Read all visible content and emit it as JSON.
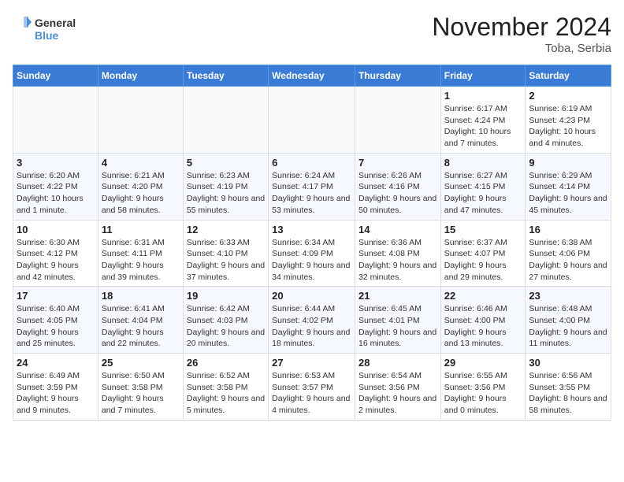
{
  "header": {
    "logo_line1": "General",
    "logo_line2": "Blue",
    "month": "November 2024",
    "location": "Toba, Serbia"
  },
  "days_of_week": [
    "Sunday",
    "Monday",
    "Tuesday",
    "Wednesday",
    "Thursday",
    "Friday",
    "Saturday"
  ],
  "weeks": [
    [
      {
        "day": "",
        "info": ""
      },
      {
        "day": "",
        "info": ""
      },
      {
        "day": "",
        "info": ""
      },
      {
        "day": "",
        "info": ""
      },
      {
        "day": "",
        "info": ""
      },
      {
        "day": "1",
        "info": "Sunrise: 6:17 AM\nSunset: 4:24 PM\nDaylight: 10 hours and 7 minutes."
      },
      {
        "day": "2",
        "info": "Sunrise: 6:19 AM\nSunset: 4:23 PM\nDaylight: 10 hours and 4 minutes."
      }
    ],
    [
      {
        "day": "3",
        "info": "Sunrise: 6:20 AM\nSunset: 4:22 PM\nDaylight: 10 hours and 1 minute."
      },
      {
        "day": "4",
        "info": "Sunrise: 6:21 AM\nSunset: 4:20 PM\nDaylight: 9 hours and 58 minutes."
      },
      {
        "day": "5",
        "info": "Sunrise: 6:23 AM\nSunset: 4:19 PM\nDaylight: 9 hours and 55 minutes."
      },
      {
        "day": "6",
        "info": "Sunrise: 6:24 AM\nSunset: 4:17 PM\nDaylight: 9 hours and 53 minutes."
      },
      {
        "day": "7",
        "info": "Sunrise: 6:26 AM\nSunset: 4:16 PM\nDaylight: 9 hours and 50 minutes."
      },
      {
        "day": "8",
        "info": "Sunrise: 6:27 AM\nSunset: 4:15 PM\nDaylight: 9 hours and 47 minutes."
      },
      {
        "day": "9",
        "info": "Sunrise: 6:29 AM\nSunset: 4:14 PM\nDaylight: 9 hours and 45 minutes."
      }
    ],
    [
      {
        "day": "10",
        "info": "Sunrise: 6:30 AM\nSunset: 4:12 PM\nDaylight: 9 hours and 42 minutes."
      },
      {
        "day": "11",
        "info": "Sunrise: 6:31 AM\nSunset: 4:11 PM\nDaylight: 9 hours and 39 minutes."
      },
      {
        "day": "12",
        "info": "Sunrise: 6:33 AM\nSunset: 4:10 PM\nDaylight: 9 hours and 37 minutes."
      },
      {
        "day": "13",
        "info": "Sunrise: 6:34 AM\nSunset: 4:09 PM\nDaylight: 9 hours and 34 minutes."
      },
      {
        "day": "14",
        "info": "Sunrise: 6:36 AM\nSunset: 4:08 PM\nDaylight: 9 hours and 32 minutes."
      },
      {
        "day": "15",
        "info": "Sunrise: 6:37 AM\nSunset: 4:07 PM\nDaylight: 9 hours and 29 minutes."
      },
      {
        "day": "16",
        "info": "Sunrise: 6:38 AM\nSunset: 4:06 PM\nDaylight: 9 hours and 27 minutes."
      }
    ],
    [
      {
        "day": "17",
        "info": "Sunrise: 6:40 AM\nSunset: 4:05 PM\nDaylight: 9 hours and 25 minutes."
      },
      {
        "day": "18",
        "info": "Sunrise: 6:41 AM\nSunset: 4:04 PM\nDaylight: 9 hours and 22 minutes."
      },
      {
        "day": "19",
        "info": "Sunrise: 6:42 AM\nSunset: 4:03 PM\nDaylight: 9 hours and 20 minutes."
      },
      {
        "day": "20",
        "info": "Sunrise: 6:44 AM\nSunset: 4:02 PM\nDaylight: 9 hours and 18 minutes."
      },
      {
        "day": "21",
        "info": "Sunrise: 6:45 AM\nSunset: 4:01 PM\nDaylight: 9 hours and 16 minutes."
      },
      {
        "day": "22",
        "info": "Sunrise: 6:46 AM\nSunset: 4:00 PM\nDaylight: 9 hours and 13 minutes."
      },
      {
        "day": "23",
        "info": "Sunrise: 6:48 AM\nSunset: 4:00 PM\nDaylight: 9 hours and 11 minutes."
      }
    ],
    [
      {
        "day": "24",
        "info": "Sunrise: 6:49 AM\nSunset: 3:59 PM\nDaylight: 9 hours and 9 minutes."
      },
      {
        "day": "25",
        "info": "Sunrise: 6:50 AM\nSunset: 3:58 PM\nDaylight: 9 hours and 7 minutes."
      },
      {
        "day": "26",
        "info": "Sunrise: 6:52 AM\nSunset: 3:58 PM\nDaylight: 9 hours and 5 minutes."
      },
      {
        "day": "27",
        "info": "Sunrise: 6:53 AM\nSunset: 3:57 PM\nDaylight: 9 hours and 4 minutes."
      },
      {
        "day": "28",
        "info": "Sunrise: 6:54 AM\nSunset: 3:56 PM\nDaylight: 9 hours and 2 minutes."
      },
      {
        "day": "29",
        "info": "Sunrise: 6:55 AM\nSunset: 3:56 PM\nDaylight: 9 hours and 0 minutes."
      },
      {
        "day": "30",
        "info": "Sunrise: 6:56 AM\nSunset: 3:55 PM\nDaylight: 8 hours and 58 minutes."
      }
    ]
  ]
}
